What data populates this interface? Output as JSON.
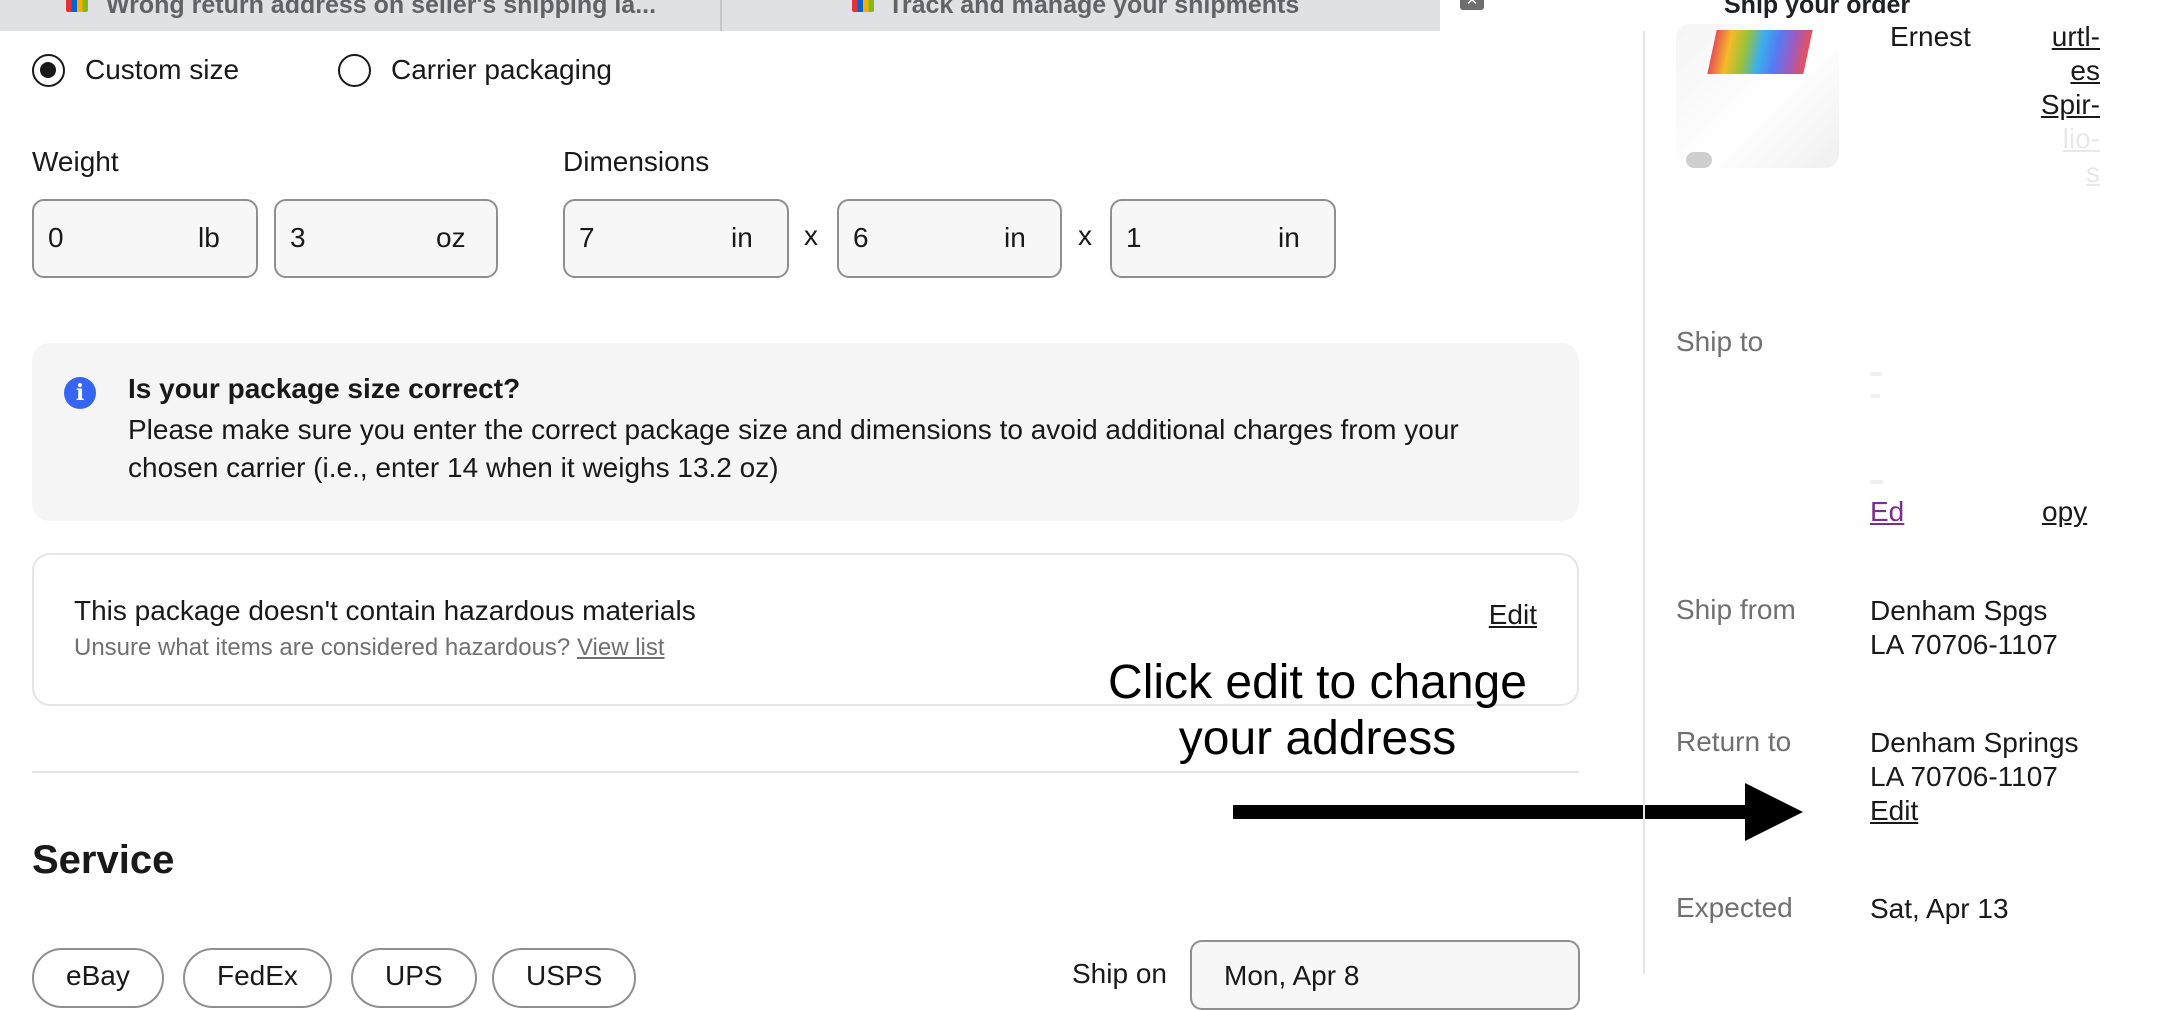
{
  "tabs": [
    {
      "label": "Wrong return address on seller's shipping la...",
      "active": false
    },
    {
      "label": "Track and manage your shipments",
      "active": false
    },
    {
      "label": "Ship your order",
      "active": true
    }
  ],
  "package_type": {
    "options": [
      "Custom size",
      "Carrier packaging"
    ],
    "selected": "Custom size"
  },
  "weight": {
    "label": "Weight",
    "lb_value": "0",
    "lb_unit": "lb",
    "oz_value": "3",
    "oz_unit": "oz"
  },
  "dimensions": {
    "label": "Dimensions",
    "length": "7",
    "width": "6",
    "height": "1",
    "unit": "in",
    "separator": "x"
  },
  "info_notice": {
    "title": "Is your package size correct?",
    "body": "Please make sure you enter the correct package size and dimensions to avoid additional charges from your chosen carrier (i.e., enter 14 when it weighs 13.2 oz)"
  },
  "hazardous": {
    "title": "This package doesn't contain hazardous materials",
    "subtitle": "Unsure what items are considered hazardous?",
    "view_link": "View list",
    "edit": "Edit"
  },
  "service": {
    "title": "Service",
    "carriers": [
      "eBay",
      "FedEx",
      "UPS",
      "USPS"
    ],
    "ship_on_label": "Ship on",
    "ship_on_value": "Mon, Apr 8"
  },
  "annotation": {
    "text": "Click edit to change your address"
  },
  "order_summary": {
    "item_title_fragments": [
      "Ernest",
      "urtl-",
      "es",
      "Spir-",
      "lio-",
      "s"
    ],
    "ship_to_label": "Ship to",
    "ship_to_links": [
      "Ed",
      "opy"
    ],
    "ship_from_label": "Ship from",
    "ship_from_lines": [
      "Denham Spgs",
      "LA 70706-1107"
    ],
    "return_to_label": "Return to",
    "return_to_lines": [
      "Denham Springs",
      "LA 70706-1107"
    ],
    "return_to_edit": "Edit",
    "expected_label": "Expected",
    "expected_value": "Sat, Apr 13"
  },
  "colors": {
    "accent_blue": "#3665f3",
    "link_purple": "#7b2e8e"
  }
}
